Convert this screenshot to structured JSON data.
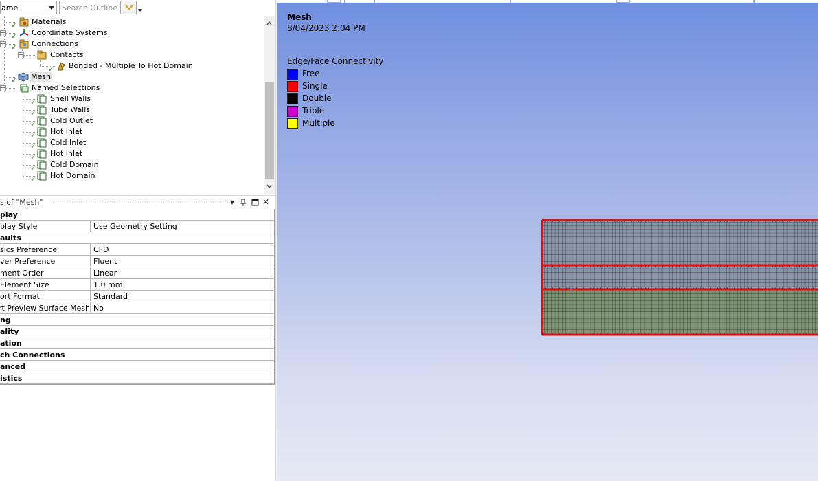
{
  "outline": {
    "filter_label": "ame",
    "search_placeholder": "Search Outline",
    "tree": [
      {
        "label": "Materials",
        "icon": "materials-folder-icon"
      },
      {
        "label": "Coordinate Systems",
        "icon": "coordinate-systems-icon"
      },
      {
        "label": "Connections",
        "icon": "connections-folder-icon"
      },
      {
        "label": "Contacts",
        "icon": "contacts-folder-icon"
      },
      {
        "label": "Bonded - Multiple To Hot Domain",
        "icon": "bonded-contact-icon"
      },
      {
        "label": "Mesh",
        "icon": "mesh-icon"
      },
      {
        "label": "Named Selections",
        "icon": "named-selections-icon"
      },
      {
        "label": "Shell Walls",
        "icon": "named-selection-icon"
      },
      {
        "label": "Tube Walls",
        "icon": "named-selection-icon"
      },
      {
        "label": "Cold Outlet",
        "icon": "named-selection-icon"
      },
      {
        "label": "Hot Inlet",
        "icon": "named-selection-icon"
      },
      {
        "label": "Cold Inlet",
        "icon": "named-selection-icon"
      },
      {
        "label": "Hot Inlet",
        "icon": "named-selection-icon"
      },
      {
        "label": "Cold Domain",
        "icon": "named-selection-icon"
      },
      {
        "label": "Hot Domain",
        "icon": "named-selection-icon"
      }
    ]
  },
  "details": {
    "title": "s of \"Mesh\"",
    "rows": [
      {
        "key": "play",
        "section": true
      },
      {
        "key": "play Style",
        "value": "Use Geometry Setting"
      },
      {
        "key": "aults",
        "section": true
      },
      {
        "key": "sics Preference",
        "value": "CFD"
      },
      {
        "key": "ver Preference",
        "value": "Fluent"
      },
      {
        "key": "ment Order",
        "value": "Linear"
      },
      {
        "key": "Element Size",
        "value": "1.0 mm"
      },
      {
        "key": "ort Format",
        "value": "Standard"
      },
      {
        "key": "ort Preview Surface Mesh",
        "value": "No"
      },
      {
        "key": "ng",
        "section": true
      },
      {
        "key": "ality",
        "section": true
      },
      {
        "key": "ation",
        "section": true
      },
      {
        "key": "ch Connections",
        "section": true
      },
      {
        "key": "anced",
        "section": true
      },
      {
        "key": "istics",
        "section": true
      }
    ]
  },
  "viewport": {
    "title": "Mesh",
    "date": "8/04/2023 2:04 PM",
    "legend_title": "Edge/Face Connectivity",
    "legend": [
      {
        "label": "Free",
        "color": "#0000ff"
      },
      {
        "label": "Single",
        "color": "#ff0000"
      },
      {
        "label": "Double",
        "color": "#000000"
      },
      {
        "label": "Triple",
        "color": "#d000d0"
      },
      {
        "label": "Multiple",
        "color": "#ffff00"
      }
    ]
  },
  "colors": {
    "mesh_edge": "#e01010",
    "mesh_fill_top": "#8a96a8",
    "mesh_fill_bottom": "#7e9474"
  }
}
